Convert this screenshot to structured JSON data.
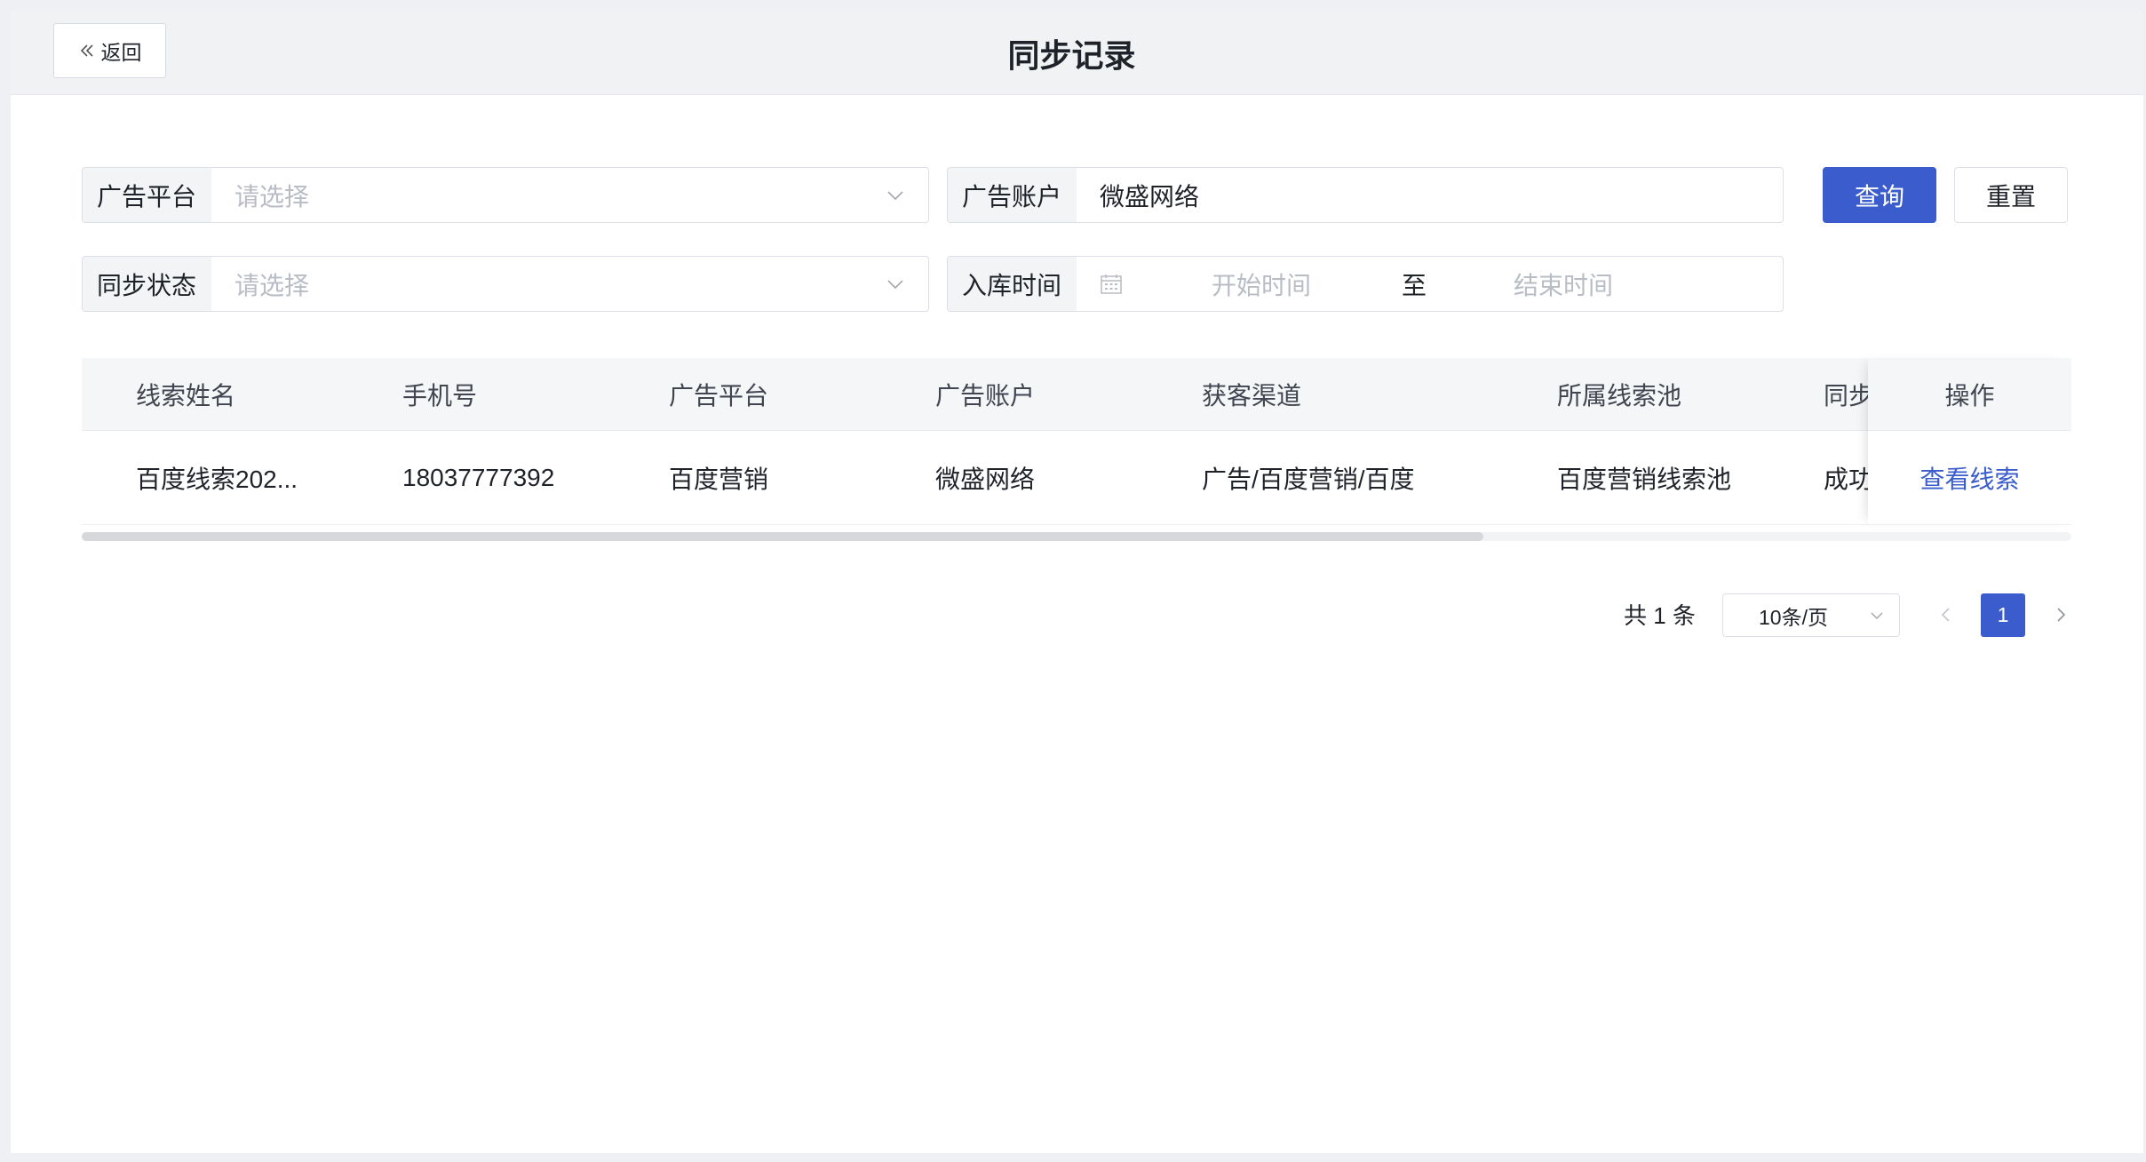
{
  "header": {
    "back_label": "返回",
    "title": "同步记录"
  },
  "filters": {
    "ad_platform": {
      "label": "广告平台",
      "placeholder": "请选择"
    },
    "ad_account": {
      "label": "广告账户",
      "value": "微盛网络"
    },
    "sync_status": {
      "label": "同步状态",
      "placeholder": "请选择"
    },
    "storage_time": {
      "label": "入库时间",
      "start_placeholder": "开始时间",
      "separator": "至",
      "end_placeholder": "结束时间"
    },
    "query_label": "查询",
    "reset_label": "重置"
  },
  "table": {
    "columns": [
      "线索姓名",
      "手机号",
      "广告平台",
      "广告账户",
      "获客渠道",
      "所属线索池",
      "同步"
    ],
    "action_column": "操作",
    "rows": [
      {
        "cells": [
          "百度线索202...",
          "18037777392",
          "百度营销",
          "微盛网络",
          "广告/百度营销/百度",
          "百度营销线索池",
          "成功"
        ],
        "action": "查看线索"
      }
    ]
  },
  "pagination": {
    "total_text": "共 1 条",
    "page_size": "10条/页",
    "current_page": "1"
  },
  "colors": {
    "primary": "#3a5ccc",
    "header_bg": "#f1f2f4",
    "placeholder": "#b8bcc4"
  }
}
